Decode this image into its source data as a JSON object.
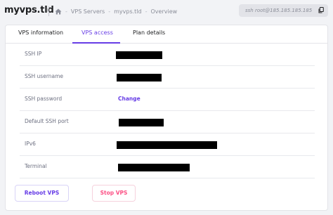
{
  "header": {
    "title": "myvps.tld",
    "breadcrumbs": [
      "VPS Servers",
      "myvps.tld",
      "Overview"
    ],
    "ssh_command": "ssh root@185.185.185.185"
  },
  "tabs": [
    {
      "label": "VPS information",
      "active": false
    },
    {
      "label": "VPS access",
      "active": true
    },
    {
      "label": "Plan details",
      "active": false
    }
  ],
  "access": {
    "ssh_ip_label": "SSH IP",
    "ssh_username_label": "SSH username",
    "ssh_password_label": "SSH password",
    "ssh_password_action": "Change",
    "ssh_port_label": "Default SSH port",
    "ipv6_label": "IPv6",
    "terminal_label": "Terminal"
  },
  "actions": {
    "reboot_label": "Reboot VPS",
    "stop_label": "Stop VPS"
  },
  "colors": {
    "accent": "#673de6",
    "danger": "#fc5185",
    "background": "#f2f3f6"
  }
}
